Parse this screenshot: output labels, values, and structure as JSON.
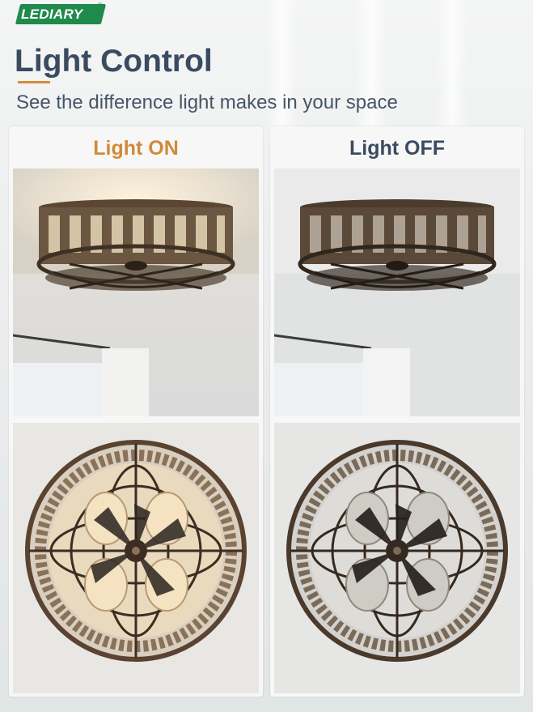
{
  "brand": {
    "name": "LEDIARY",
    "mark": "®",
    "color": "#1f8a4c"
  },
  "header": {
    "title": "Light Control",
    "subtitle": "See the difference light makes in your space",
    "accent_color": "#d58a3a"
  },
  "panels": [
    {
      "label": "Light ON",
      "label_color": "#d18a3a"
    },
    {
      "label": "Light OFF",
      "label_color": "#3b4b60"
    }
  ]
}
